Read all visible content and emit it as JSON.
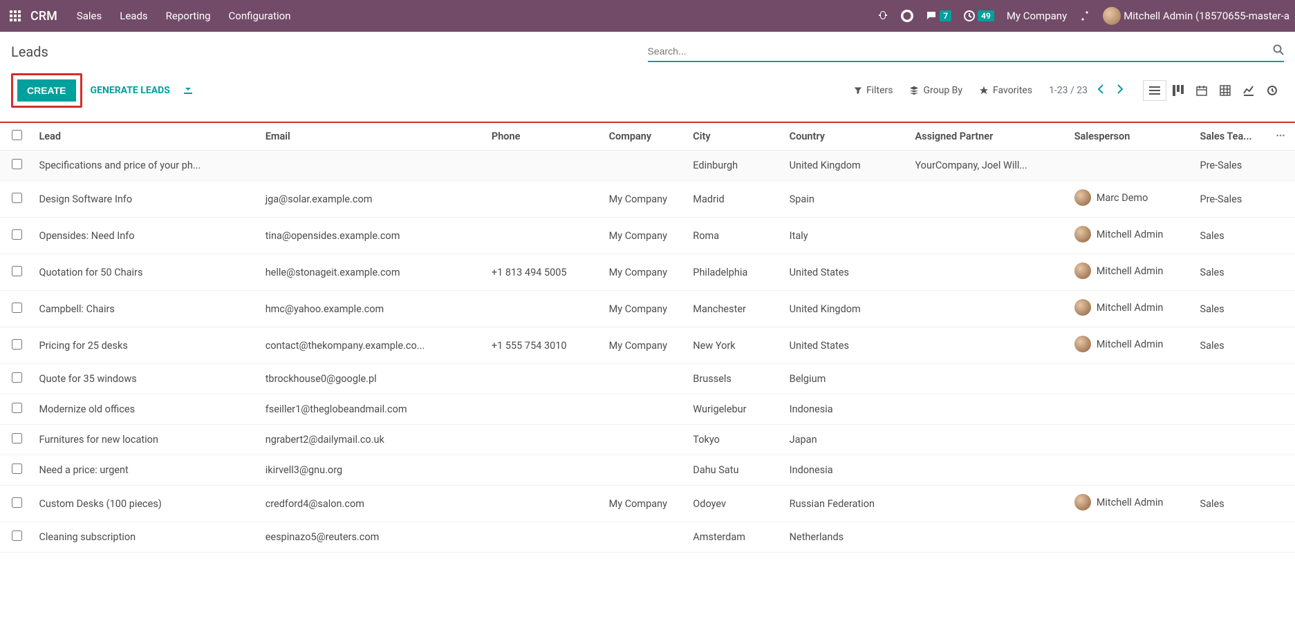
{
  "topbar": {
    "brand": "CRM",
    "menu": [
      "Sales",
      "Leads",
      "Reporting",
      "Configuration"
    ],
    "discuss_count": "7",
    "activities_count": "49",
    "company": "My Company",
    "user": "Mitchell Admin (18570655-master-a"
  },
  "breadcrumb": "Leads",
  "search": {
    "placeholder": "Search...",
    "value": ""
  },
  "buttons": {
    "create": "CREATE",
    "generate": "GENERATE LEADS"
  },
  "tools": {
    "filters": "Filters",
    "groupby": "Group By",
    "favorites": "Favorites"
  },
  "pager": "1-23 / 23",
  "columns": {
    "lead": "Lead",
    "email": "Email",
    "phone": "Phone",
    "company": "Company",
    "city": "City",
    "country": "Country",
    "partner": "Assigned Partner",
    "salesperson": "Salesperson",
    "team": "Sales Tea..."
  },
  "rows": [
    {
      "lead": "Specifications and price of your ph...",
      "email": "",
      "phone": "",
      "company": "",
      "city": "Edinburgh",
      "country": "United Kingdom",
      "partner": "YourCompany, Joel Will...",
      "salesperson": "",
      "team": "Pre-Sales"
    },
    {
      "lead": "Design Software Info",
      "email": "jga@solar.example.com",
      "phone": "",
      "company": "My Company",
      "city": "Madrid",
      "country": "Spain",
      "partner": "",
      "salesperson": "Marc Demo",
      "team": "Pre-Sales"
    },
    {
      "lead": "Opensides: Need Info",
      "email": "tina@opensides.example.com",
      "phone": "",
      "company": "My Company",
      "city": "Roma",
      "country": "Italy",
      "partner": "",
      "salesperson": "Mitchell Admin",
      "team": "Sales"
    },
    {
      "lead": "Quotation for 50 Chairs",
      "email": "helle@stonageit.example.com",
      "phone": "+1 813 494 5005",
      "company": "My Company",
      "city": "Philadelphia",
      "country": "United States",
      "partner": "",
      "salesperson": "Mitchell Admin",
      "team": "Sales"
    },
    {
      "lead": "Campbell: Chairs",
      "email": "hmc@yahoo.example.com",
      "phone": "",
      "company": "My Company",
      "city": "Manchester",
      "country": "United Kingdom",
      "partner": "",
      "salesperson": "Mitchell Admin",
      "team": "Sales"
    },
    {
      "lead": "Pricing for 25 desks",
      "email": "contact@thekompany.example.co...",
      "phone": "+1 555 754 3010",
      "company": "My Company",
      "city": "New York",
      "country": "United States",
      "partner": "",
      "salesperson": "Mitchell Admin",
      "team": "Sales"
    },
    {
      "lead": "Quote for 35 windows",
      "email": "tbrockhouse0@google.pl",
      "phone": "",
      "company": "",
      "city": "Brussels",
      "country": "Belgium",
      "partner": "",
      "salesperson": "",
      "team": ""
    },
    {
      "lead": "Modernize old offices",
      "email": "fseiller1@theglobeandmail.com",
      "phone": "",
      "company": "",
      "city": "Wurigelebur",
      "country": "Indonesia",
      "partner": "",
      "salesperson": "",
      "team": ""
    },
    {
      "lead": "Furnitures for new location",
      "email": "ngrabert2@dailymail.co.uk",
      "phone": "",
      "company": "",
      "city": "Tokyo",
      "country": "Japan",
      "partner": "",
      "salesperson": "",
      "team": ""
    },
    {
      "lead": "Need a price: urgent",
      "email": "ikirvell3@gnu.org",
      "phone": "",
      "company": "",
      "city": "Dahu Satu",
      "country": "Indonesia",
      "partner": "",
      "salesperson": "",
      "team": ""
    },
    {
      "lead": "Custom Desks (100 pieces)",
      "email": "credford4@salon.com",
      "phone": "",
      "company": "My Company",
      "city": "Odoyev",
      "country": "Russian Federation",
      "partner": "",
      "salesperson": "Mitchell Admin",
      "team": "Sales"
    },
    {
      "lead": "Cleaning subscription",
      "email": "eespinazo5@reuters.com",
      "phone": "",
      "company": "",
      "city": "Amsterdam",
      "country": "Netherlands",
      "partner": "",
      "salesperson": "",
      "team": ""
    }
  ]
}
